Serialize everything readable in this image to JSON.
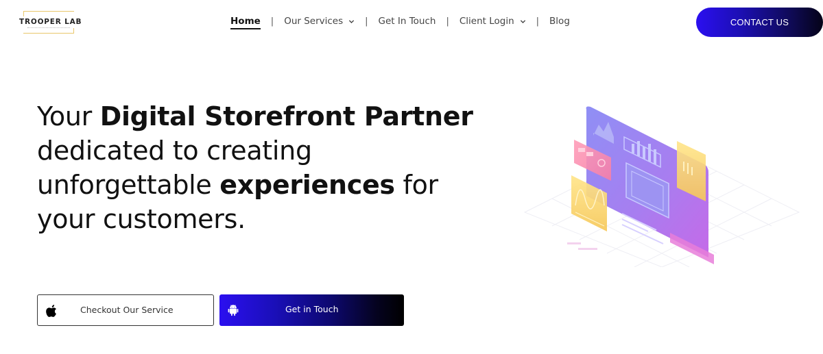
{
  "brand": {
    "logo_text": "TROOPER LAB"
  },
  "nav": {
    "items": [
      {
        "label": "Home",
        "active": true
      },
      {
        "label": "Our Services",
        "dropdown": true
      },
      {
        "label": "Get In Touch"
      },
      {
        "label": "Client Login",
        "dropdown": true
      },
      {
        "label": "Blog"
      }
    ],
    "separator": "|"
  },
  "header": {
    "contact_label": "CONTACT US"
  },
  "hero": {
    "line1_normal": "Your ",
    "line1_bold": "Digital Storefront Partner",
    "line2": "dedicated to creating",
    "line3_normal_a": "unforgettable ",
    "line3_bold": "experiences",
    "line3_normal_b": " for",
    "line4": "your customers."
  },
  "actions": {
    "secondary_label": "Checkout Our Service",
    "secondary_icon": "apple-icon",
    "primary_label": "Get in Touch",
    "primary_icon": "android-icon"
  },
  "colors": {
    "accent": "#2b0ff0",
    "accent_dark": "#000000",
    "logo_gold": "#e9c76a"
  }
}
